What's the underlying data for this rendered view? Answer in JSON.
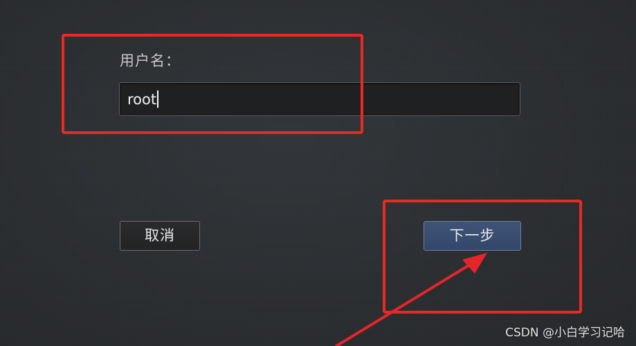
{
  "form": {
    "username_label": "用户名：",
    "username_value": "root",
    "cancel_label": "取消",
    "next_label": "下一步"
  },
  "annotations": {
    "highlight_color": "#ea2a22",
    "arrow_color": "#e8242b"
  },
  "watermark": "CSDN @小白学习记哈",
  "colors": {
    "background": "#2e3134",
    "input_bg": "#1f2022",
    "primary_button": "#3a4f72",
    "text": "#c6c8ca"
  },
  "icons": {
    "arrow": "arrow-pointer-icon"
  }
}
